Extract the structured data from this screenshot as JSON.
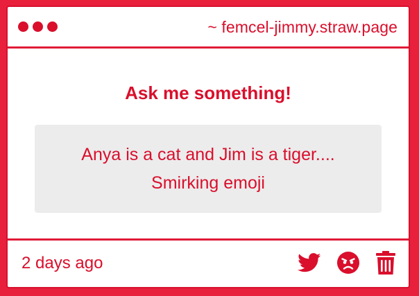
{
  "window": {
    "url": "~ femcel-jimmy.straw.page"
  },
  "main": {
    "heading": "Ask me something!",
    "question": "Anya is a cat and Jim is a tiger.... Smirking emoji"
  },
  "footer": {
    "timestamp": "2 days ago",
    "actions": [
      "twitter-icon",
      "angry-face-icon",
      "trash-icon"
    ]
  },
  "colors": {
    "accent": "#d90f2c",
    "background": "#e8203c",
    "question_box": "#ececec"
  }
}
